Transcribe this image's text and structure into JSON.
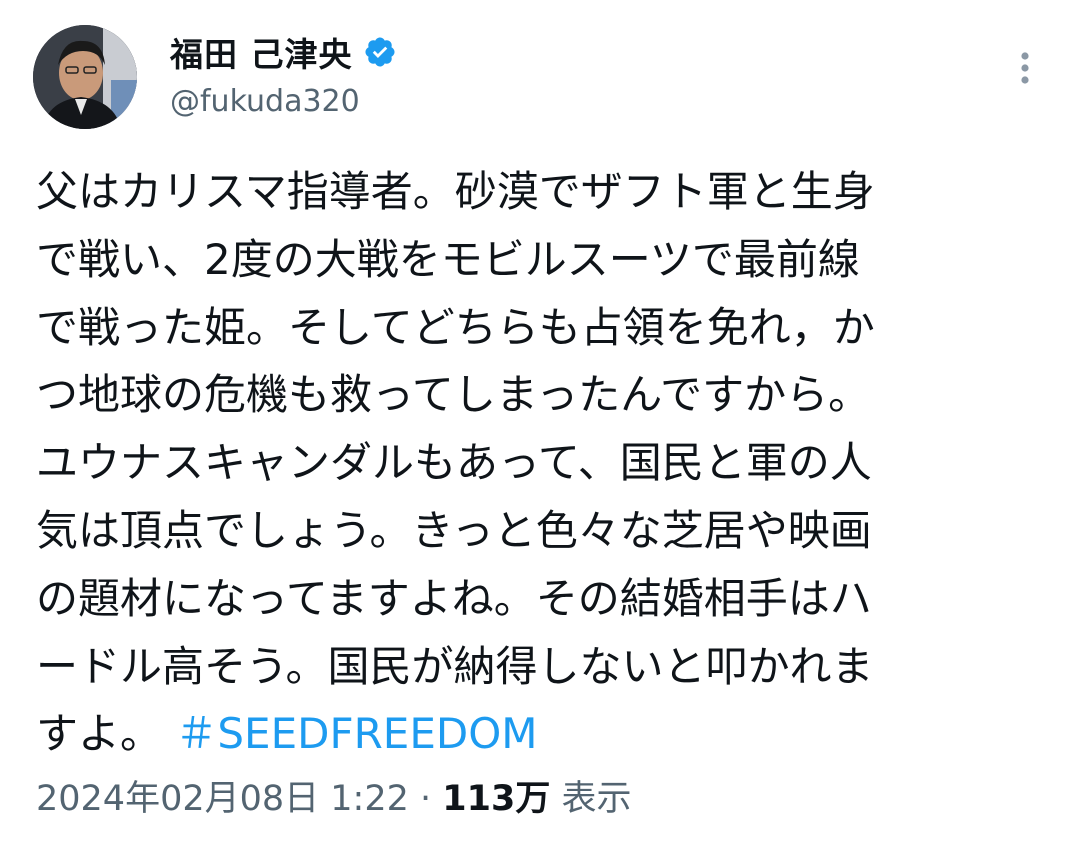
{
  "author": {
    "display_name": "福田 己津央",
    "handle": "@fukuda320",
    "verified": true,
    "verified_color": "#1d9bf0"
  },
  "tweet": {
    "text_lines": [
      "父はカリスマ指導者。砂漠でザフト軍と生身",
      "で戦い、2度の大戦をモビルスーツで最前線",
      "で戦った姫。そしてどちらも占領を免れ，か",
      "つ地球の危機も救ってしまったんですから。",
      "ユウナスキャンダルもあって、国民と軍の人",
      "気は頂点でしょう。きっと色々な芝居や映画",
      "の題材になってますよね。その結婚相手はハ",
      "ードル高そう。国民が納得しないと叩かれま",
      "すよ。"
    ],
    "hashtag": "＃SEEDFREEDOM",
    "hashtag_color": "#1d9bf0"
  },
  "meta": {
    "datetime": "2024年02月08日 1:22",
    "separator": " · ",
    "views_count": "113万",
    "views_label": " 表示"
  },
  "icons": {
    "more": "more-vertical-icon",
    "verified": "verified-badge-icon"
  }
}
